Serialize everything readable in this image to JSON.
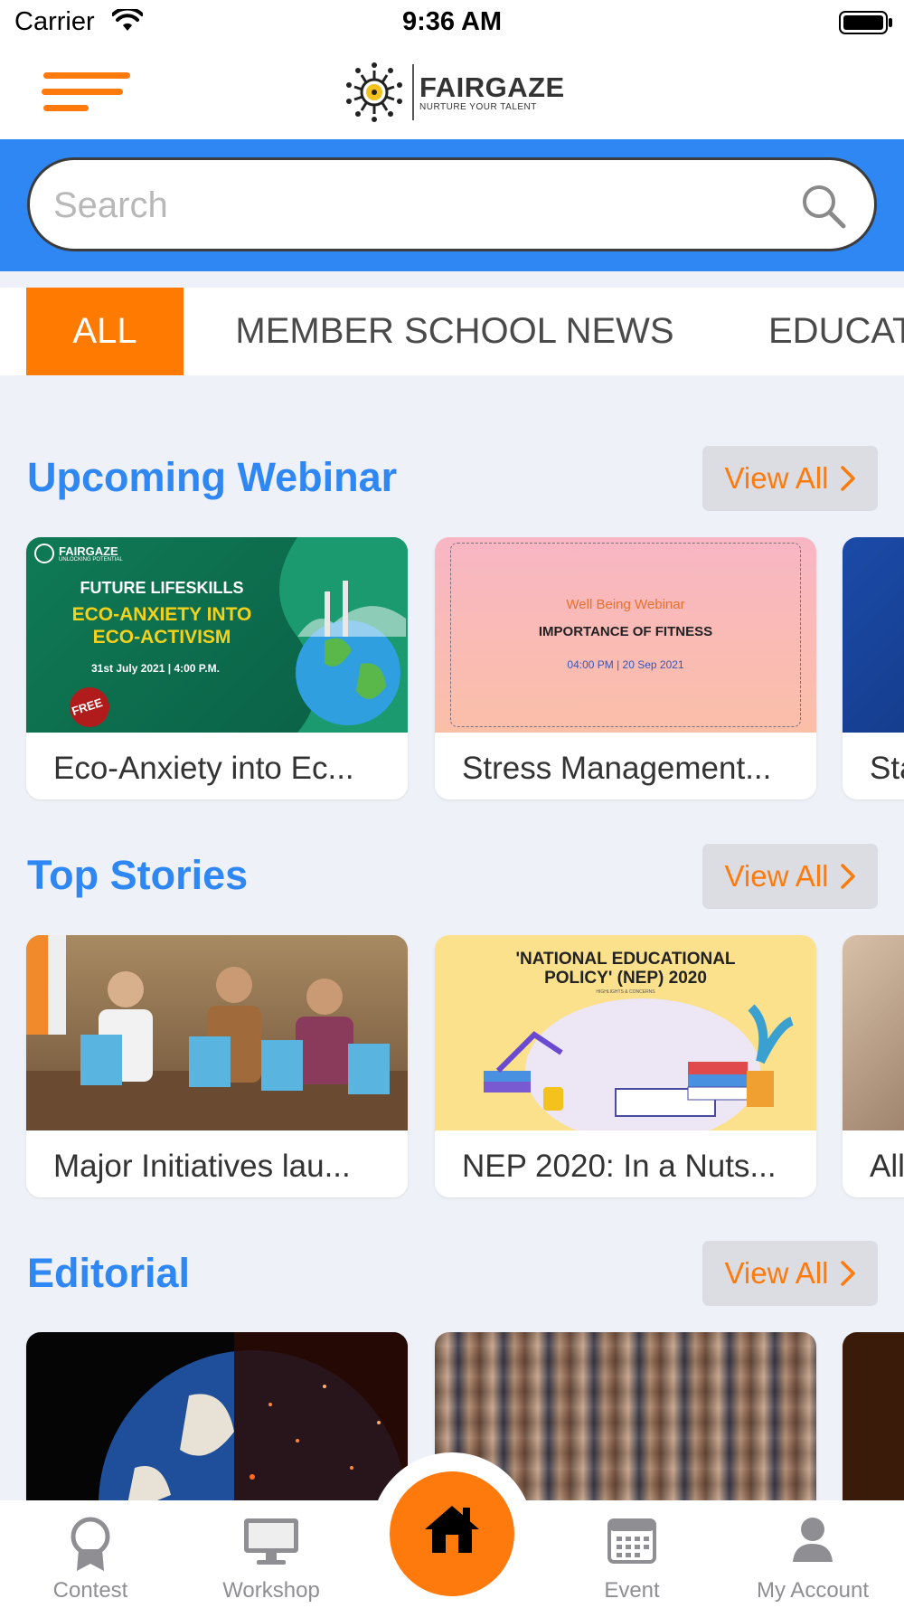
{
  "status_bar": {
    "carrier": "Carrier",
    "time": "9:36 AM"
  },
  "header": {
    "logo_name": "FAIRGAZE",
    "logo_tagline": "NURTURE YOUR TALENT"
  },
  "search": {
    "placeholder": "Search",
    "value": ""
  },
  "tabs": [
    {
      "label": "ALL",
      "active": true
    },
    {
      "label": "MEMBER SCHOOL NEWS",
      "active": false
    },
    {
      "label": "EDUCAT",
      "active": false
    }
  ],
  "sections": {
    "webinar": {
      "title": "Upcoming Webinar",
      "view_all": "View All",
      "cards": [
        {
          "caption": "Eco-Anxiety into Ec...",
          "img": {
            "brand": "FAIRGAZE",
            "brand_sub": "UNLOCKING POTENTIAL",
            "line1": "FUTURE LIFESKILLS",
            "line2": "ECO-ANXIETY  INTO",
            "line3": "ECO-ACTIVISM",
            "date": "31st July 2021",
            "time": "4:00 P.M.",
            "badge": "FREE"
          }
        },
        {
          "caption": "Stress Management...",
          "img": {
            "line1": "Well Being Webinar",
            "line2": "IMPORTANCE OF FITNESS",
            "line3": "04:00 PM | 20 Sep 2021"
          }
        },
        {
          "caption": "Sta"
        }
      ]
    },
    "stories": {
      "title": "Top Stories",
      "view_all": "View All",
      "cards": [
        {
          "caption": "Major Initiatives lau..."
        },
        {
          "caption": "NEP 2020: In a Nuts...",
          "img": {
            "line1": "'NATIONAL EDUCATIONAL",
            "line2": "POLICY' (NEP) 2020",
            "line3": "HIGHLIGHTS & CONCERNS"
          }
        },
        {
          "caption": "All"
        }
      ]
    },
    "editorial": {
      "title": "Editorial",
      "view_all": "View All"
    }
  },
  "tabbar": {
    "items": [
      {
        "label": "Contest",
        "icon": "award-icon"
      },
      {
        "label": "Workshop",
        "icon": "monitor-icon"
      },
      {
        "label": "",
        "icon": "home-icon",
        "active": true
      },
      {
        "label": "Event",
        "icon": "calendar-icon"
      },
      {
        "label": "My Account",
        "icon": "user-icon"
      }
    ]
  },
  "colors": {
    "accent_orange": "#ff7a0d",
    "brand_blue": "#2f87f3",
    "page_bg": "#eef1f8"
  }
}
